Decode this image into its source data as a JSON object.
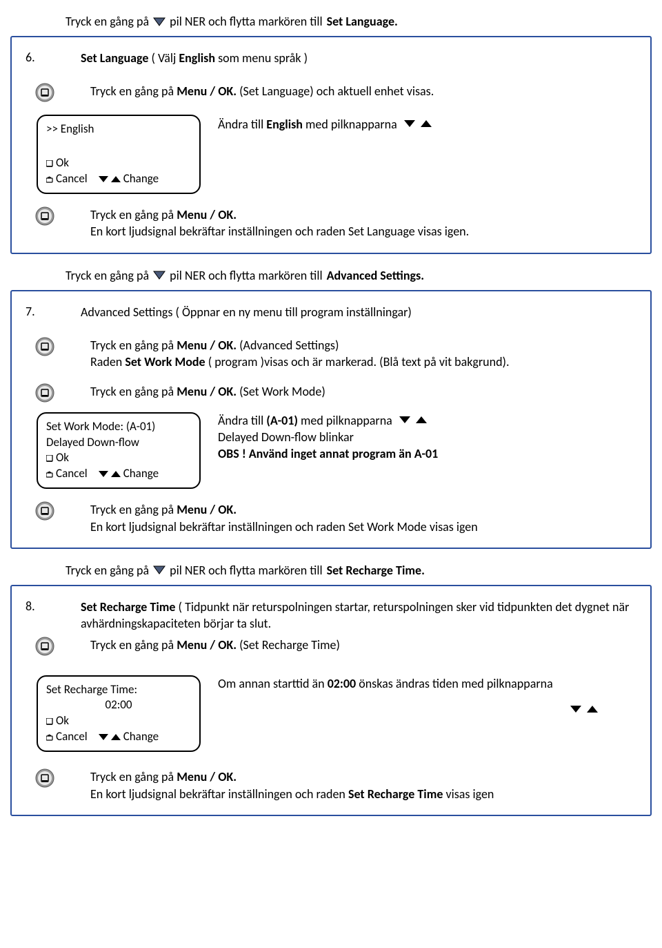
{
  "intro_line": {
    "a": "Tryck en gång på ",
    "b": " pil NER och flytta markören till ",
    "target": "Set Language."
  },
  "step6": {
    "num": "6.",
    "title_a": "Set Language",
    "title_b": " ( Välj ",
    "title_c": "English",
    "title_d": " som menu språk )",
    "line1_a": "Tryck en gång på ",
    "line1_b": "Menu / OK.",
    "line1_c": " (Set Language) och aktuell enhet visas.",
    "screen_sel": ">> English",
    "screen_ok": "Ok",
    "screen_cancel": "Cancel",
    "screen_change": "Change",
    "right_a": "Ändra till ",
    "right_b": "English",
    "right_c": " med pilknapparna",
    "line2_a": "Tryck en gång på ",
    "line2_b": "Menu / OK.",
    "line3": "En kort ljudsignal bekräftar inställningen och raden Set Language visas igen."
  },
  "inter67": {
    "a": "Tryck en gång på ",
    "b": " pil NER och flytta markören till ",
    "target": "Advanced Settings."
  },
  "step7": {
    "num": "7.",
    "title": "Advanced Settings ( Öppnar en ny menu till program inställningar)",
    "l1_a": "Tryck en gång på ",
    "l1_b": "Menu / OK.",
    "l1_c": " (Advanced Settings)",
    "l2_a": "Raden ",
    "l2_b": "Set Work Mode",
    "l2_c": " ( program )visas och är markerad. (Blå text på vit bakgrund).",
    "l3_a": "Tryck en gång på ",
    "l3_b": "Menu / OK.",
    "l3_c": " (Set Work Mode)",
    "screen_l1": "Set Work Mode: (A-01)",
    "screen_l2": "Delayed Down-flow",
    "screen_ok": "Ok",
    "screen_cancel": "Cancel",
    "screen_change": "Change",
    "r1_a": "Ändra till ",
    "r1_b": "(A-01)",
    "r1_c": " med pilknapparna",
    "r2": "Delayed Down-flow blinkar",
    "r3": "OBS ! Använd inget annat program än A-01",
    "l4_a": "Tryck en gång på ",
    "l4_b": "Menu / OK.",
    "l5": "En kort ljudsignal bekräftar inställningen och raden Set Work Mode visas igen"
  },
  "inter78": {
    "a": "Tryck en gång på ",
    "b": " pil NER och flytta markören till ",
    "target": "Set Recharge Time."
  },
  "step8": {
    "num": "8.",
    "title_a": "Set Recharge Time",
    "title_b": " ( Tidpunkt när returspolningen startar, returspolningen sker vid tidpunkten det dygnet när avhärdningskapaciteten börjar ta slut.",
    "l1_a": "Tryck en gång på ",
    "l1_b": "Menu / OK.",
    "l1_c": " (Set Recharge Time)",
    "screen_l1": "Set Recharge Time:",
    "screen_l2": "02:00",
    "screen_ok": "Ok",
    "screen_cancel": "Cancel",
    "screen_change": "Change",
    "r1_a": "Om annan starttid än ",
    "r1_b": "02:00",
    "r1_c": " önskas ändras tiden med pilknapparna",
    "l2_a": "Tryck en gång på ",
    "l2_b": "Menu / OK.",
    "l3_a": "En kort ljudsignal bekräftar inställningen och raden ",
    "l3_b": "Set Recharge Time",
    "l3_c": " visas igen"
  }
}
